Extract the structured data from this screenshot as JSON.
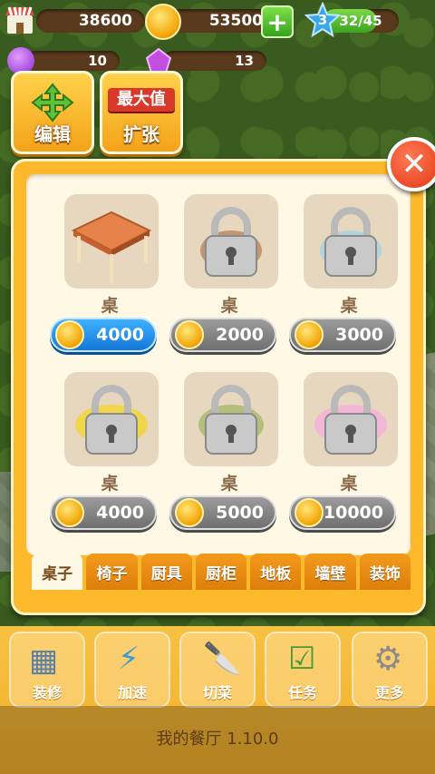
{
  "top": {
    "money": "38600",
    "coins": "53500",
    "level": "3",
    "exp": "32/45",
    "exp_progress": 0.71,
    "gems": "10",
    "tickets": "13"
  },
  "buttons": {
    "edit": "编辑",
    "expand_badge": "最大值",
    "expand": "扩张"
  },
  "panel": {
    "close_glyph": "✕",
    "items": [
      {
        "name": "桌",
        "price": "4000",
        "locked": false,
        "selected": true
      },
      {
        "name": "桌",
        "price": "2000",
        "locked": true,
        "selected": false
      },
      {
        "name": "桌",
        "price": "3000",
        "locked": true,
        "selected": false
      },
      {
        "name": "桌",
        "price": "4000",
        "locked": true,
        "selected": false
      },
      {
        "name": "桌",
        "price": "5000",
        "locked": true,
        "selected": false
      },
      {
        "name": "桌",
        "price": "10000",
        "locked": true,
        "selected": false
      }
    ],
    "tabs": [
      "桌子",
      "椅子",
      "厨具",
      "厨柜",
      "地板",
      "墙壁",
      "装饰"
    ],
    "active_tab": 0
  },
  "bottom": {
    "buttons": [
      "装修",
      "加速",
      "切菜",
      "任务",
      "更多"
    ],
    "version": "我的餐厅 1.10.0"
  },
  "colors": {
    "accent": "#fbb92b",
    "selected_price": "#1577d8",
    "close": "#e23814"
  }
}
